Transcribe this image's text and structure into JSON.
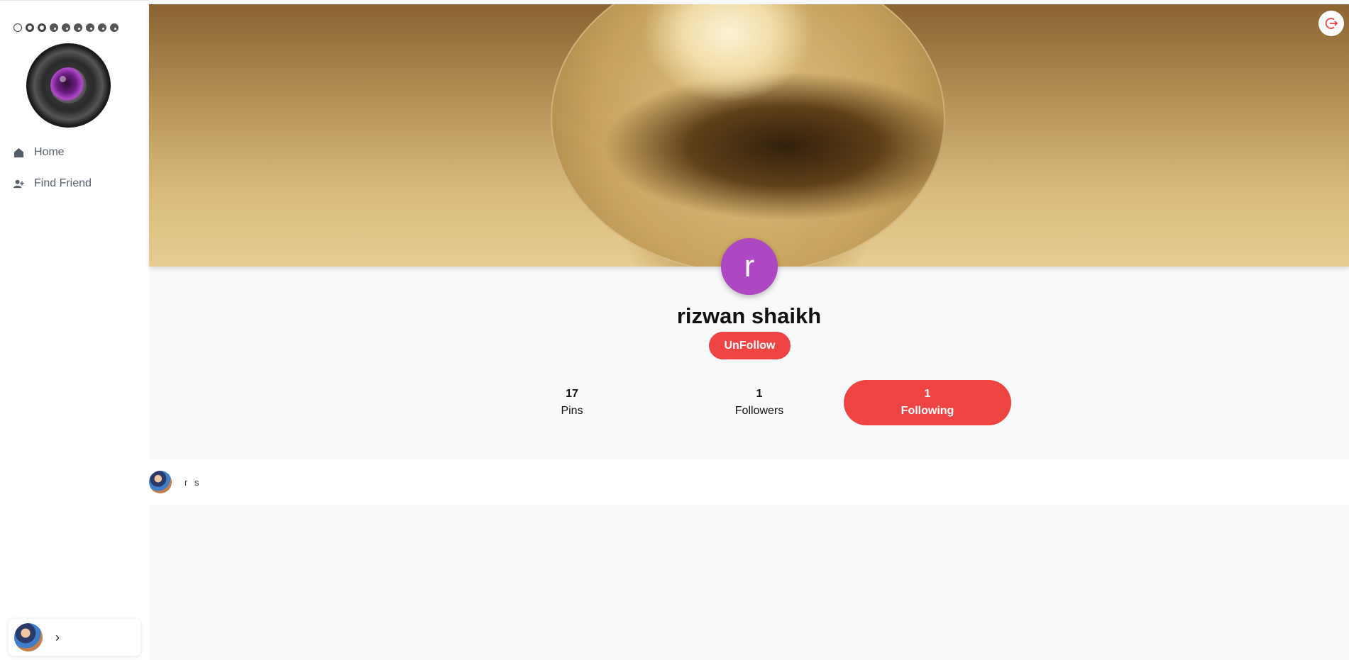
{
  "sidebar": {
    "nav": [
      {
        "label": "Home",
        "icon": "home-icon"
      },
      {
        "label": "Find Friend",
        "icon": "user-plus-icon"
      }
    ]
  },
  "profile": {
    "initial": "r",
    "name": "rizwan shaikh",
    "action_label": "UnFollow",
    "stats": {
      "pins": {
        "value": "17",
        "label": "Pins"
      },
      "followers": {
        "value": "1",
        "label": "Followers"
      },
      "following": {
        "value": "1",
        "label": "Following"
      }
    }
  },
  "following_list": [
    {
      "name": "r s"
    }
  ],
  "colors": {
    "accent": "#ef4444",
    "avatar": "#ae47c2"
  }
}
